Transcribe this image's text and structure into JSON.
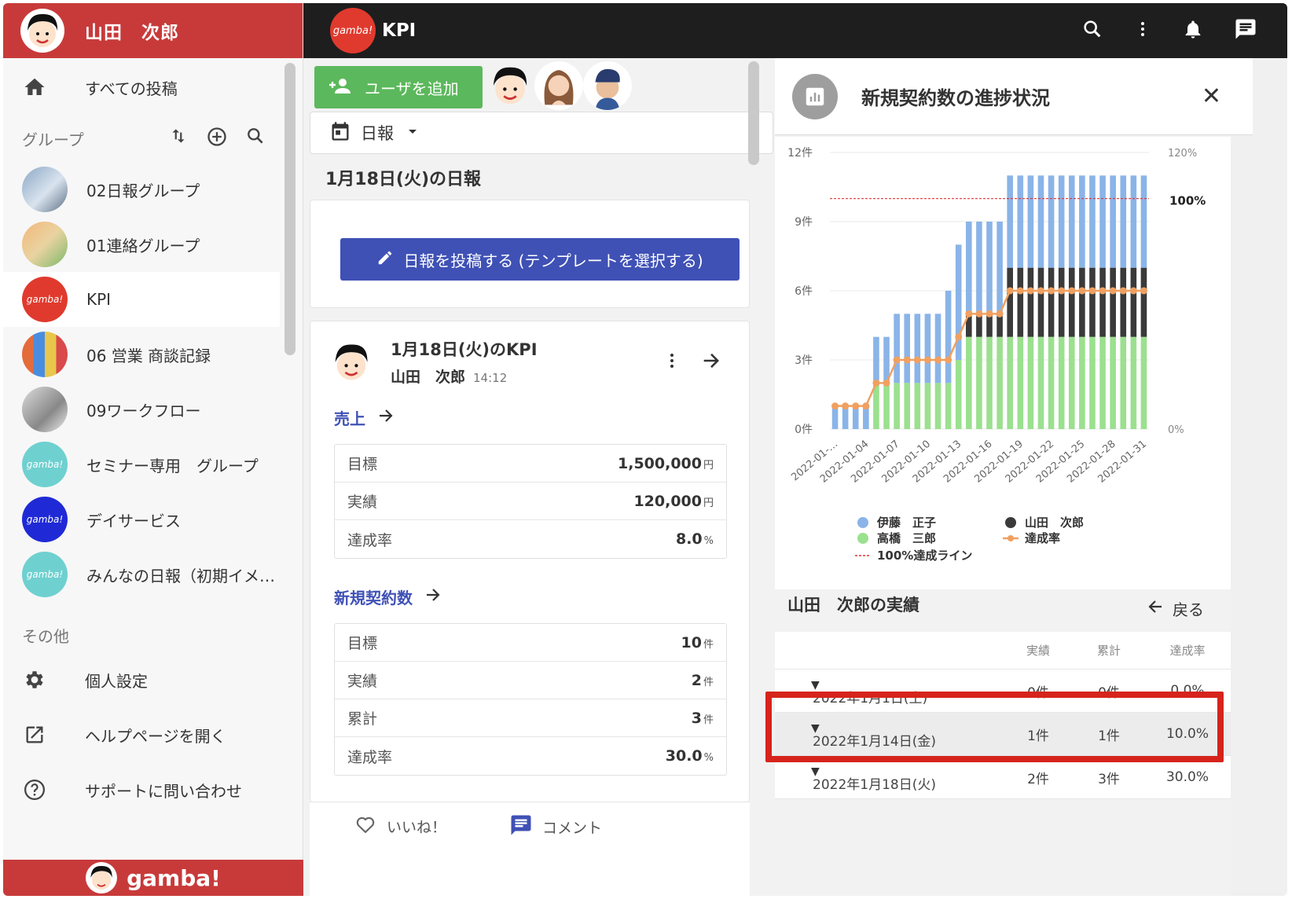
{
  "user": {
    "name": "山田　次郎"
  },
  "sidebar": {
    "all_posts": "すべての投稿",
    "group_label": "グループ",
    "groups": [
      {
        "label": "02日報グループ"
      },
      {
        "label": "01連絡グループ"
      },
      {
        "label": "KPI"
      },
      {
        "label": "06 営業 商談記録"
      },
      {
        "label": "09ワークフロー"
      },
      {
        "label": "セミナー専用　グループ"
      },
      {
        "label": "デイサービス"
      },
      {
        "label": "みんなの日報（初期イメ…"
      }
    ],
    "other_label": "その他",
    "other_items": [
      {
        "label": "個人設定"
      },
      {
        "label": "ヘルプページを開く"
      },
      {
        "label": "サポートに問い合わせ"
      }
    ],
    "footer_brand": "gamba!",
    "logo_text": "gamba!"
  },
  "topbar": {
    "title": "KPI"
  },
  "middle": {
    "add_user": "ユーザを追加",
    "report_type": "日報",
    "report_date": "1月18日(火)の日報",
    "post_button": "日報を投稿する (テンプレートを選択する)",
    "kpi_title": "1月18日(火)のKPI",
    "kpi_user": "山田　次郎",
    "kpi_time": "14:12",
    "sales": {
      "label": "売上",
      "rows": [
        {
          "k": "目標",
          "v": "1,500,000",
          "u": "円"
        },
        {
          "k": "実績",
          "v": "120,000",
          "u": "円"
        },
        {
          "k": "達成率",
          "v": "8.0",
          "u": "%"
        }
      ]
    },
    "contracts": {
      "label": "新規契約数",
      "rows": [
        {
          "k": "目標",
          "v": "10",
          "u": "件"
        },
        {
          "k": "実績",
          "v": "2",
          "u": "件"
        },
        {
          "k": "累計",
          "v": "3",
          "u": "件"
        },
        {
          "k": "達成率",
          "v": "30.0",
          "u": "%"
        }
      ]
    },
    "like": "いいね！",
    "comment": "コメント"
  },
  "right": {
    "title": "新規契約数の進捗状況",
    "results_title": "山田　次郎の実績",
    "back": "戻る",
    "headers": [
      "実績",
      "累計",
      "達成率"
    ],
    "rows": [
      {
        "date": "2022年1月1日(土)",
        "a": "0件",
        "b": "0件",
        "c": "0.0%"
      },
      {
        "date": "2022年1月14日(金)",
        "a": "1件",
        "b": "1件",
        "c": "10.0%"
      },
      {
        "date": "2022年1月18日(火)",
        "a": "2件",
        "b": "3件",
        "c": "30.0%"
      }
    ]
  },
  "chart_data": {
    "type": "bar",
    "stacked": true,
    "x": [
      "2022-01-01",
      "2022-01-02",
      "2022-01-03",
      "2022-01-04",
      "2022-01-05",
      "2022-01-06",
      "2022-01-07",
      "2022-01-08",
      "2022-01-09",
      "2022-01-10",
      "2022-01-11",
      "2022-01-12",
      "2022-01-13",
      "2022-01-14",
      "2022-01-15",
      "2022-01-16",
      "2022-01-17",
      "2022-01-18",
      "2022-01-19",
      "2022-01-20",
      "2022-01-21",
      "2022-01-22",
      "2022-01-23",
      "2022-01-24",
      "2022-01-25",
      "2022-01-26",
      "2022-01-27",
      "2022-01-28",
      "2022-01-29",
      "2022-01-30",
      "2022-01-31"
    ],
    "tick_labels": [
      "2022-01-…",
      "2022-01-04",
      "2022-01-07",
      "2022-01-10",
      "2022-01-13",
      "2022-01-16",
      "2022-01-19",
      "2022-01-22",
      "2022-01-25",
      "2022-01-28",
      "2022-01-31"
    ],
    "series": [
      {
        "name": "高橋　三郎",
        "color": "#9be08f",
        "values": [
          0,
          0,
          0,
          0,
          2,
          2,
          2,
          2,
          2,
          2,
          2,
          2,
          3,
          4,
          4,
          4,
          4,
          4,
          4,
          4,
          4,
          4,
          4,
          4,
          4,
          4,
          4,
          4,
          4,
          4,
          4
        ]
      },
      {
        "name": "山田　次郎",
        "color": "#3a3a3a",
        "values": [
          0,
          0,
          0,
          0,
          0,
          0,
          0,
          0,
          0,
          0,
          0,
          0,
          0,
          1,
          1,
          1,
          1,
          3,
          3,
          3,
          3,
          3,
          3,
          3,
          3,
          3,
          3,
          3,
          3,
          3,
          3
        ]
      },
      {
        "name": "伊藤　正子",
        "color": "#8ab4e8",
        "values": [
          1,
          1,
          1,
          1,
          2,
          2,
          3,
          3,
          3,
          3,
          3,
          4,
          5,
          4,
          4,
          4,
          4,
          4,
          4,
          4,
          4,
          4,
          4,
          4,
          4,
          4,
          4,
          4,
          4,
          4,
          4
        ]
      }
    ],
    "rate": {
      "name": "達成率",
      "color": "#f0a060",
      "values": [
        10,
        10,
        10,
        10,
        20,
        20,
        30,
        30,
        30,
        30,
        30,
        30,
        40,
        50,
        50,
        50,
        50,
        60,
        60,
        60,
        60,
        60,
        60,
        60,
        60,
        60,
        60,
        60,
        60,
        60,
        60
      ]
    },
    "target_line": {
      "name": "100%達成ライン",
      "value": 100,
      "color": "#e03030"
    },
    "y_left": {
      "ticks": [
        "0件",
        "3件",
        "6件",
        "9件",
        "12件"
      ],
      "range": [
        0,
        12
      ]
    },
    "y_right": {
      "ticks": [
        "0%",
        "120%"
      ],
      "range": [
        0,
        120
      ],
      "annotation": "100%"
    },
    "legend": [
      "伊藤　正子",
      "山田　次郎",
      "高橋　三郎",
      "達成率",
      "100%達成ライン"
    ]
  }
}
